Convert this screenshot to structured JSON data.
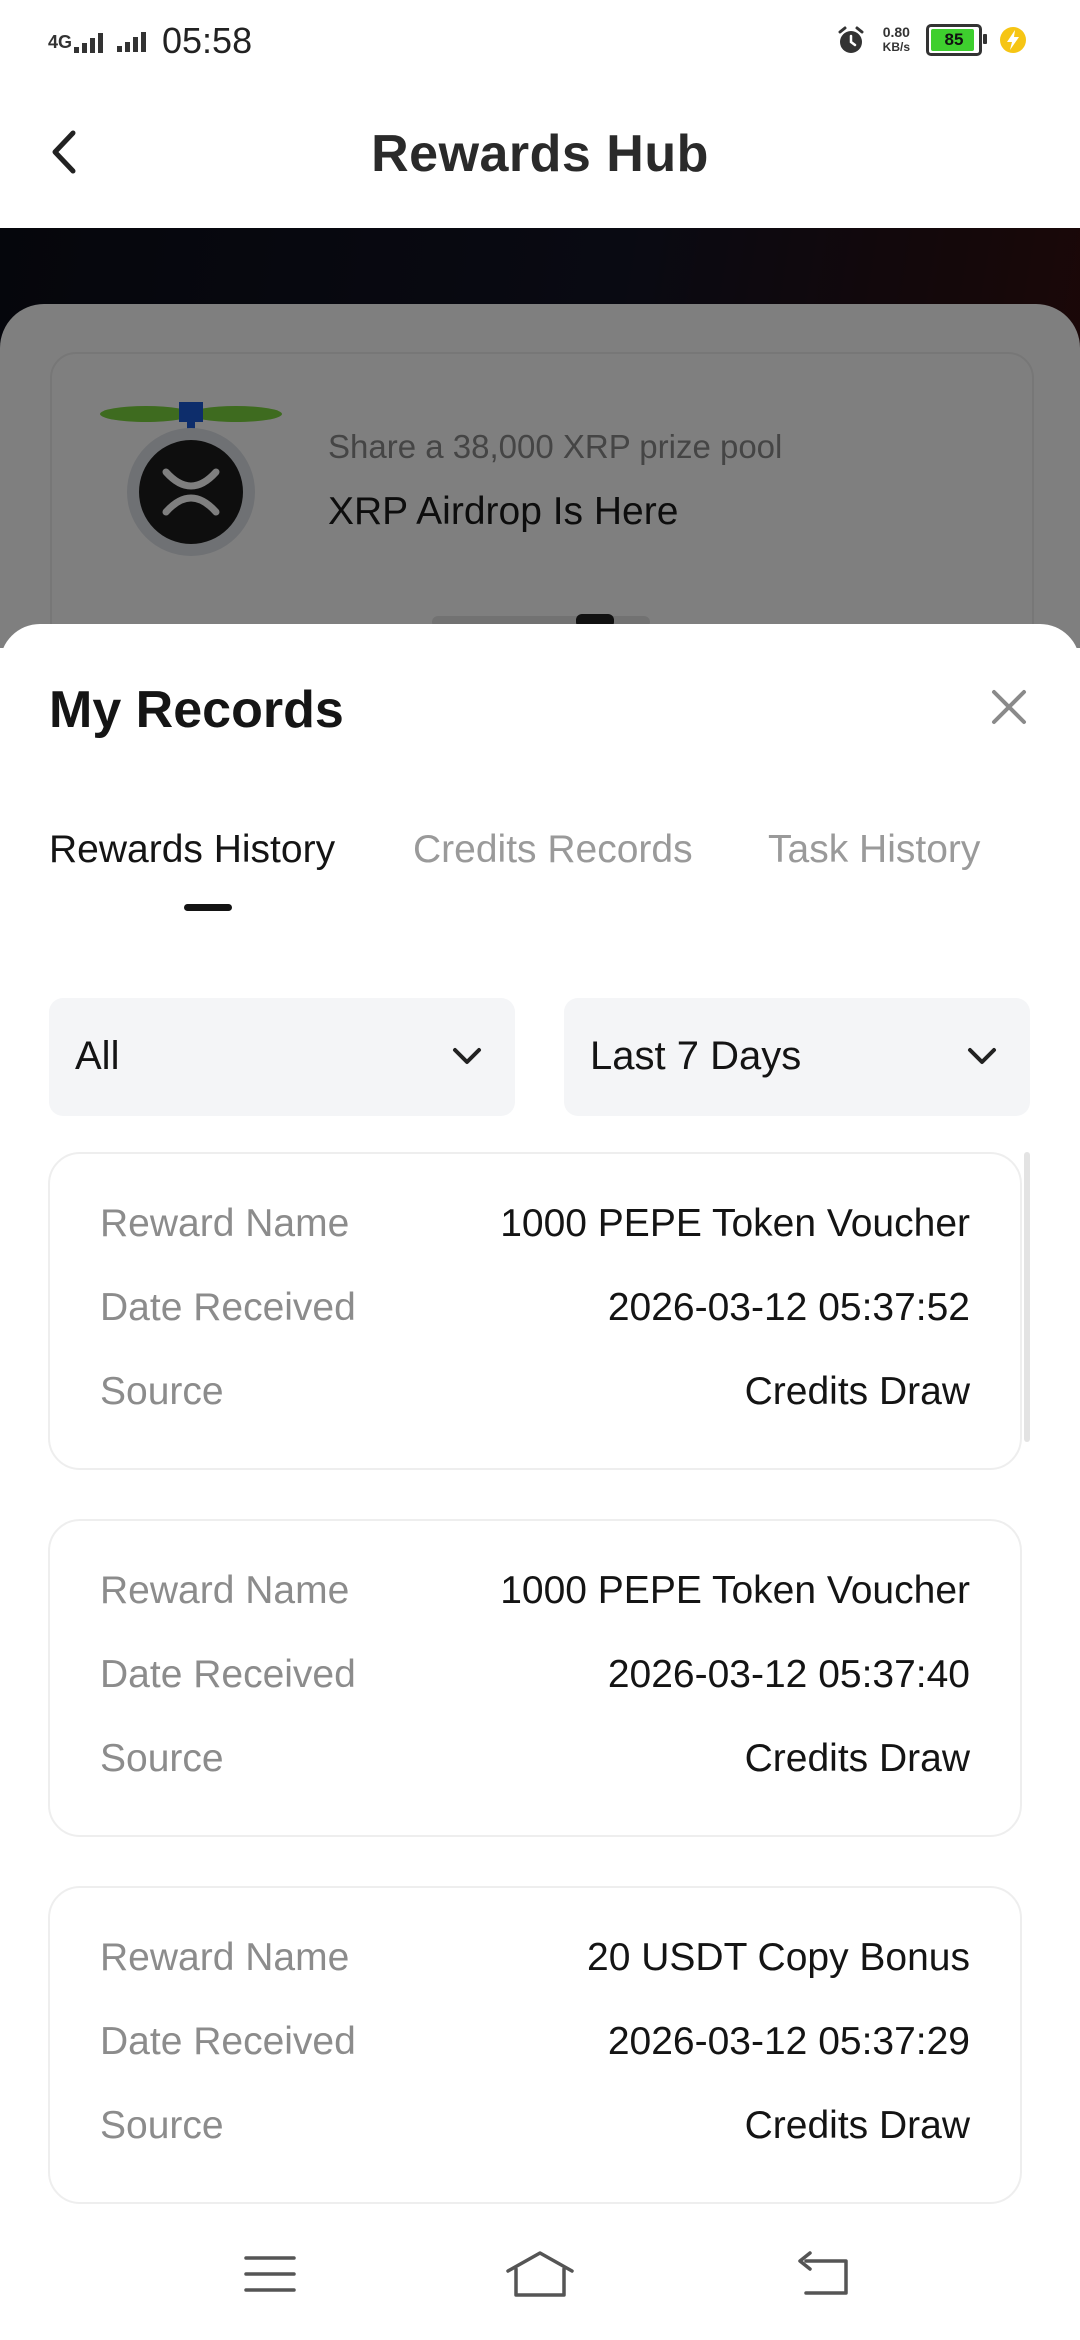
{
  "status_bar": {
    "network": "4G",
    "time": "05:58",
    "speed_value": "0.80",
    "speed_unit": "KB/s",
    "battery_level": "85",
    "battery_fraction": 0.85
  },
  "header": {
    "title": "Rewards Hub"
  },
  "banner": {
    "subtitle": "Share a 38,000 XRP prize pool",
    "title": "XRP Airdrop Is Here"
  },
  "sheet": {
    "title": "My Records",
    "tabs": [
      {
        "label": "Rewards History",
        "active": true
      },
      {
        "label": "Credits Records",
        "active": false
      },
      {
        "label": "Task History",
        "active": false
      }
    ],
    "filters": {
      "type": "All",
      "period": "Last 7 Days"
    },
    "records": [
      {
        "name_label": "Reward Name",
        "name": "1000 PEPE Token Voucher",
        "date_label": "Date Received",
        "date": "2026-03-12 05:37:52",
        "source_label": "Source",
        "source": "Credits Draw"
      },
      {
        "name_label": "Reward Name",
        "name": "1000 PEPE Token Voucher",
        "date_label": "Date Received",
        "date": "2026-03-12 05:37:40",
        "source_label": "Source",
        "source": "Credits Draw"
      },
      {
        "name_label": "Reward Name",
        "name": "20 USDT Copy Bonus",
        "date_label": "Date Received",
        "date": "2026-03-12 05:37:29",
        "source_label": "Source",
        "source": "Credits Draw"
      }
    ]
  },
  "colors": {
    "text_primary": "#141414",
    "text_secondary": "#8c8c8c",
    "tab_inactive": "#9a9a9a",
    "filter_bg": "#f4f5f7",
    "battery_fill": "#3ecf2e"
  },
  "icons": {
    "back": "back-arrow-icon",
    "close": "close-icon",
    "chevron": "chevron-down-icon",
    "nav_menu": "menu-icon",
    "nav_home": "home-icon",
    "nav_back": "nav-back-icon"
  }
}
